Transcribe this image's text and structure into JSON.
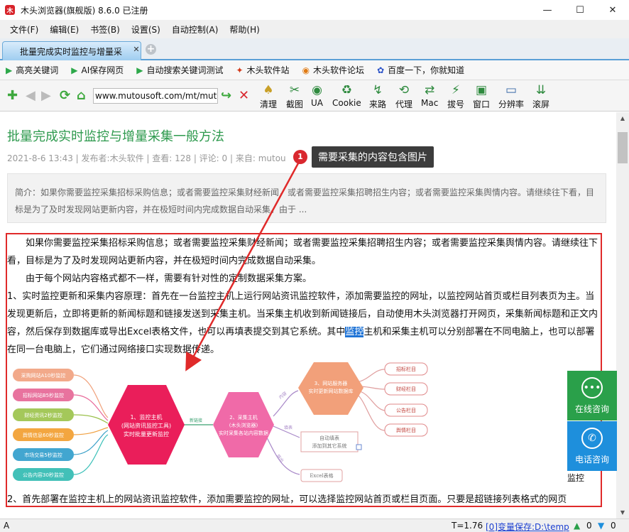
{
  "window": {
    "title": "木头浏览器(旗舰版) 8.6.0  已注册",
    "minimize": "—",
    "maximize": "☐",
    "close": "✕"
  },
  "menu": [
    "文件(F)",
    "编辑(E)",
    "书签(B)",
    "设置(S)",
    "自动控制(A)",
    "帮助(H)"
  ],
  "tab": {
    "label": "批量完成实时监控与增量采",
    "close": "✕",
    "add": "+"
  },
  "bookmarks": [
    {
      "icon": "▶",
      "label": "高亮关键词",
      "color": "#2da84a"
    },
    {
      "icon": "▶",
      "label": "AI保存网页",
      "color": "#2da84a"
    },
    {
      "icon": "▶",
      "label": "自动搜索关键词测试",
      "color": "#2da84a"
    },
    {
      "icon": "✦",
      "label": "木头软件站",
      "color": "#d23a1a"
    },
    {
      "icon": "◉",
      "label": "木头软件论坛",
      "color": "#e07a12"
    },
    {
      "icon": "✿",
      "label": "百度一下，你就知道",
      "color": "#2a52c8"
    }
  ],
  "toolbar": {
    "address": "www.mutousoft.com/mt/mutou",
    "tools": [
      "清理",
      "截图",
      "UA",
      "Cookie",
      "来路",
      "代理",
      "Mac",
      "拔号",
      "窗口",
      "分辨率",
      "滚屏"
    ]
  },
  "article": {
    "title": "批量完成实时监控与增量采集一般方法",
    "meta": "2021-8-6 13:43  |  发布者:木头软件  |  查看: 128  |  评论: 0  |  来自: mutou",
    "summary": "简介：如果你需要监控采集招标采购信息；或者需要监控采集财经新闻，或者需要监控采集招聘招生内容；或者需要监控采集舆情内容。请继续往下看，目标是为了及时发现网站更新内容，并在极短时间内完成数据自动采集。由于 ...",
    "p1": "如果你需要监控采集招标采购信息；或者需要监控采集财经新闻；或者需要监控采集招聘招生内容；或者需要监控采集舆情内容。请继续往下看，目标是为了及时发现网站更新内容，并在极短时间内完成数据自动采集。",
    "p2": "由于每个网站内容格式都不一样，需要有针对性的定制数据采集方案。",
    "p3_a": "1、实时监控更新和采集内容原理：首先在一台监控主机上运行网站资讯监控软件，添加需要监控的网址，以监控网站首页或栏目列表页为主。当发现更新后，立即将更新的新闻标题和链接发送到采集主机。当采集主机收到新闻链接后，自动使用木头浏览器打开网页，采集新闻标题和正文内容，然后保存到数据库或导出Excel表格文件，也可以再填表提交到其它系统。其中",
    "p3_hl": "监控",
    "p3_b": "主机和采集主机可以分别部署在不同电脑上，也可以部署在同一台电脑上，它们通过网络接口实现数据传递。",
    "p4": "2、首先部署在监控主机上的网站资讯监控软件，添加需要监控的网址，可以选择监控网站首页或栏目页面。只要是超链接列表格式的网页"
  },
  "callout": {
    "num": "1",
    "text": "需要采集的内容包含图片"
  },
  "mindmap": {
    "left_nodes": [
      "采购网站A10秒监控",
      "招标网站B5秒监控",
      "财经资讯2秒监控",
      "舆情信息60秒监控",
      "市场交易5秒监控",
      "公告内容30秒监控"
    ],
    "hub1": [
      "1、监控主机",
      "(网站资讯监控工具)",
      "实时批量更新监控"
    ],
    "link1": "新链接",
    "hub2": [
      "2、采集主机",
      "(木头浏览器)",
      "实时采集各站内容数据"
    ],
    "hub3": [
      "3、网站服务器",
      "实时更新网站数据库"
    ],
    "right_nodes": [
      "招标栏目",
      "财经栏目",
      "公告栏目",
      "舆情栏目"
    ],
    "branch_labels": [
      "内容",
      "填表",
      "导出"
    ],
    "mid_box": [
      "自动填表",
      "添加到其它系统"
    ],
    "excel_box": "Excel表格"
  },
  "float": {
    "online": "在线咨询",
    "phone": "电话咨询",
    "caption": "监控"
  },
  "status": {
    "left": "A",
    "time": "T=1.76",
    "var": "[0]变量保存:D:\\temp",
    "c1": "0",
    "c2": "0"
  }
}
